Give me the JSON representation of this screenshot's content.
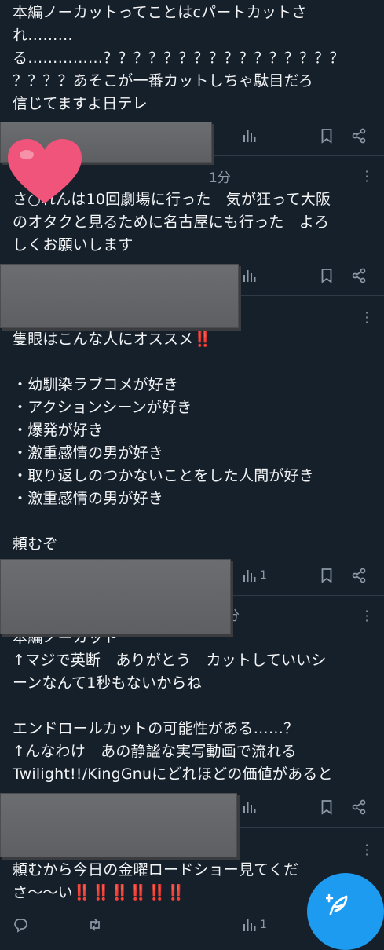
{
  "posts": [
    {
      "text_lines": [
        "本編ノーカットってことはcパートカットさ",
        "れ………",
        "る……………？？？？？？？？？？？？？？？？",
        "？？？？あそこが一番カットしちゃ駄目だろ",
        "信じてますよ日テレ"
      ]
    },
    {
      "time": "1分",
      "text_lines": [
        "さ○れんは10回劇場に行った　気が狂って大阪",
        "のオタクと見るために名古屋にも行った　よろ",
        "しくお願いします"
      ]
    },
    {
      "text_lines": [
        "隻眼はこんな人にオススメ",
        "",
        "・幼馴染ラブコメが好き",
        "・アクションシーンが好き",
        "・爆発が好き",
        "・激重感情の男が好き",
        "・取り返しのつかないことをした人間が好き",
        "・激重感情の男が好き",
        "",
        "頼むぞ"
      ],
      "emphasis": "‼️",
      "views": "1"
    },
    {
      "time": "分",
      "text_lines": [
        "本編ノーカット",
        "↑マジで英断　ありがとう　カットしていいシ",
        "ーンなんて1秒もないからね",
        "",
        "エンドロールカットの可能性がある……？",
        "↑んなわけ　あの静謐な実写動画で流れる",
        "Twilight!!/KingGnuにどれほどの価値があると"
      ]
    },
    {
      "text_lines": [
        "頼むから今日の金曜ロードショー見てくだ",
        "さ～〜い"
      ],
      "emphasis_tail": "‼️‼️‼️‼️‼️‼️",
      "views": "1"
    }
  ],
  "icons": {
    "reply": "reply-icon",
    "retweet": "retweet-icon",
    "views": "views-icon",
    "bookmark": "bookmark-icon",
    "share": "share-icon",
    "more": "more-icon",
    "compose": "compose-icon",
    "heart": "heart-sticker"
  },
  "colors": {
    "background": "#16202b",
    "text": "#f2f4f6",
    "muted": "#8b98a5",
    "accent": "#1d9bf0",
    "heart": "#f0547a",
    "emphasis": "#e0223a",
    "censor": "#6b6d70"
  }
}
